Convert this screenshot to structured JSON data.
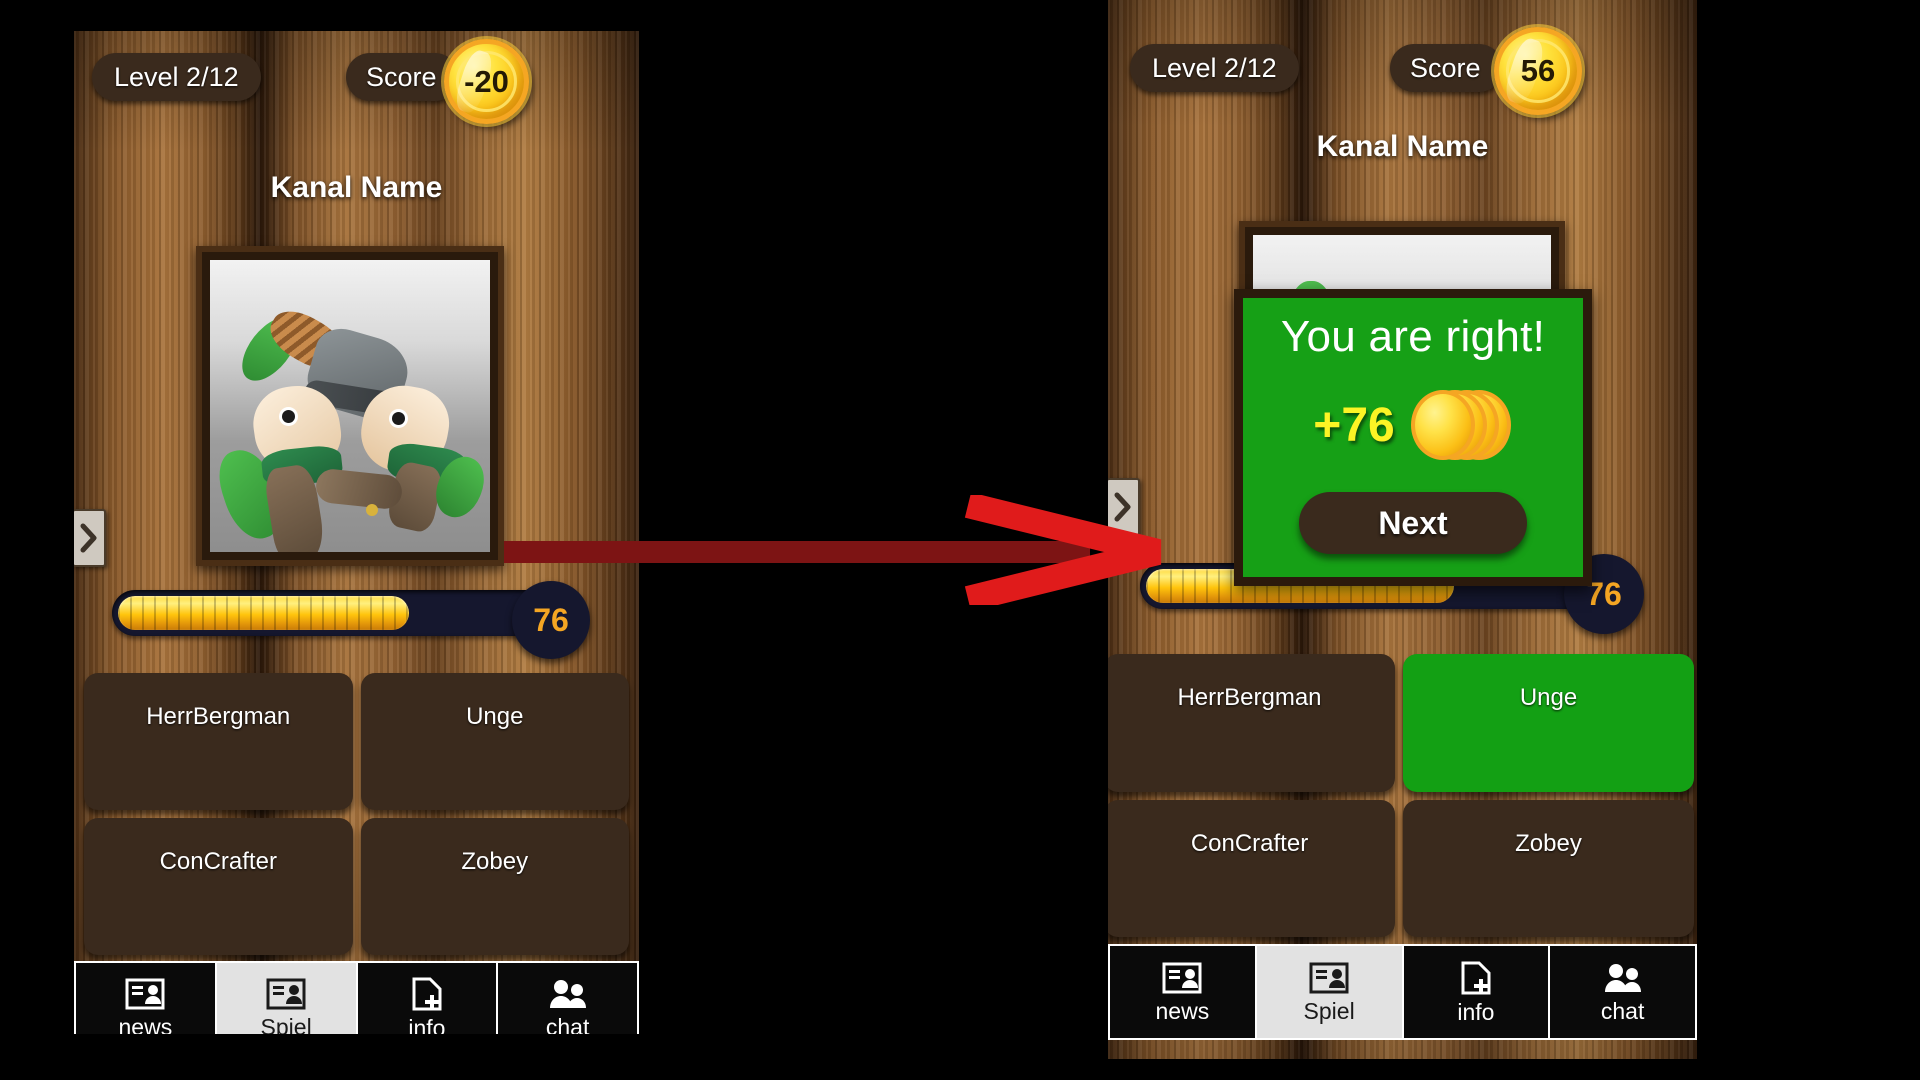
{
  "colors": {
    "wood_dark": "#3a220f",
    "wood_mid": "#8a5a2b",
    "pill_brown": "#3a2a1d",
    "correct_green": "#13a014",
    "result_green": "#16a016",
    "coin_gold": "#ffc40c",
    "progress_track": "#15172e",
    "progress_value_text": "#f5a623",
    "points_yellow": "#fcf425",
    "arrow_head": "#e01b1b",
    "arrow_shaft": "#7d1414"
  },
  "left_panel": {
    "level_badge": "Level 2/12",
    "score_label": "Score",
    "score_coin_value": "-20",
    "channel_title": "Kanal Name",
    "nav_chevron_icon": "chevron-right-icon",
    "progress": {
      "value": "76",
      "fill_percent": 68,
      "max": 100
    },
    "answers": [
      {
        "label": "HerrBergman",
        "state": "default"
      },
      {
        "label": "Unge",
        "state": "default"
      },
      {
        "label": "ConCrafter",
        "state": "default"
      },
      {
        "label": "Zobey",
        "state": "default"
      }
    ],
    "tabs": [
      {
        "label": "news",
        "icon": "contact-card-icon",
        "active": false
      },
      {
        "label": "Spiel",
        "icon": "contact-card-icon",
        "active": true
      },
      {
        "label": "info",
        "icon": "file-plus-icon",
        "active": false
      },
      {
        "label": "chat",
        "icon": "people-icon",
        "active": false
      }
    ]
  },
  "right_panel": {
    "level_badge": "Level 2/12",
    "score_label": "Score",
    "score_coin_value": "56",
    "channel_title": "Kanal Name",
    "nav_chevron_icon": "chevron-right-icon",
    "progress": {
      "value": "76",
      "fill_percent": 68,
      "max": 100
    },
    "result_overlay": {
      "title": "You are right!",
      "points": "+76",
      "coins_icon": "coin-stack-icon",
      "next_label": "Next"
    },
    "answers": [
      {
        "label": "HerrBergman",
        "state": "default"
      },
      {
        "label": "Unge",
        "state": "correct"
      },
      {
        "label": "ConCrafter",
        "state": "default"
      },
      {
        "label": "Zobey",
        "state": "default"
      }
    ],
    "tabs": [
      {
        "label": "news",
        "icon": "contact-card-icon",
        "active": false
      },
      {
        "label": "Spiel",
        "icon": "contact-card-icon",
        "active": true
      },
      {
        "label": "info",
        "icon": "file-plus-icon",
        "active": false
      },
      {
        "label": "chat",
        "icon": "people-icon",
        "active": false
      }
    ]
  },
  "annotation": {
    "arrow_icon": "right-arrow-annotation",
    "direction": "left-to-right"
  }
}
